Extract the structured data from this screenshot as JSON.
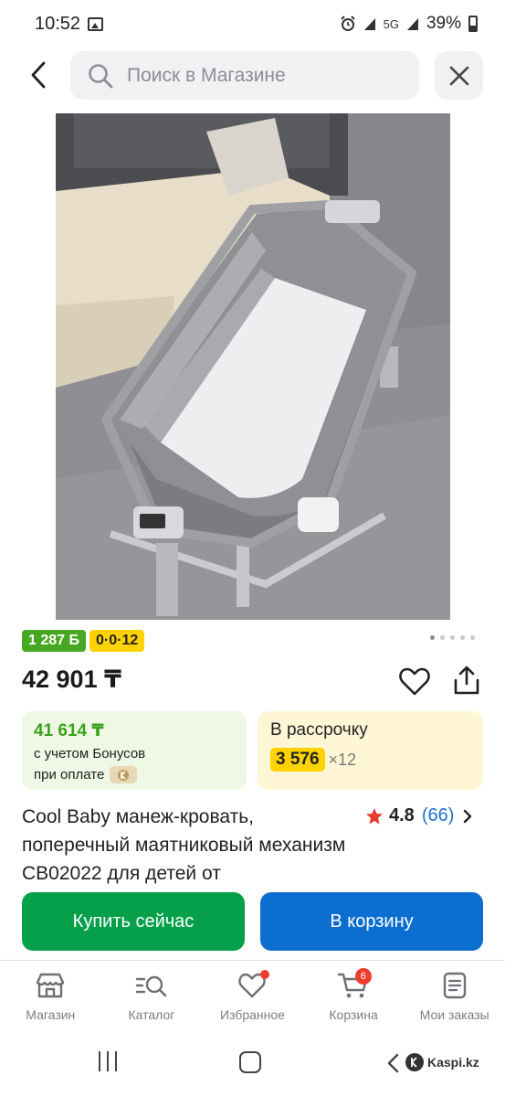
{
  "status_bar": {
    "time": "10:52",
    "network": "5G",
    "battery": "39%",
    "icons": [
      "gallery-icon",
      "alarm-icon",
      "signal-icon",
      "wifi-icon",
      "battery-icon"
    ]
  },
  "search": {
    "placeholder": "Поиск в Магазине",
    "icons": [
      "back-arrow-icon",
      "search-icon",
      "close-icon"
    ]
  },
  "product": {
    "image_alt": "Приставная кроватка-манеж серого цвета",
    "bonus_badge": "1 287 Б",
    "installment_badge": "0·0·12",
    "carousel": {
      "count": 5,
      "active_index": 0
    },
    "price": "42 901 ₸",
    "title": "Cool Baby манеж-кровать, поперечный маятниковый механизм CB02022 для детей от",
    "rating": {
      "value": "4.8",
      "reviews": "(66)"
    }
  },
  "bonus_offer": {
    "amount": "41 614 ₸",
    "line1": "с учетом Бонусов",
    "line2": "при оплате"
  },
  "credit_offer": {
    "title": "В рассрочку",
    "monthly": "3 576",
    "months": "×12"
  },
  "actions": {
    "buy_now": "Купить сейчас",
    "add_to_cart": "В корзину"
  },
  "bottom_nav": [
    {
      "label": "Магазин",
      "icon": "store-icon"
    },
    {
      "label": "Каталог",
      "icon": "catalog-search-icon"
    },
    {
      "label": "Избранное",
      "icon": "heart-icon",
      "dot": true
    },
    {
      "label": "Корзина",
      "icon": "cart-icon",
      "badge": "6"
    },
    {
      "label": "Мои заказы",
      "icon": "orders-icon"
    }
  ],
  "watermark": "Kaspi.kz",
  "colors": {
    "green_badge": "#46a820",
    "yellow_badge": "#ffd200",
    "buy_button": "#07a04a",
    "cart_button": "#0d6ed1",
    "link_blue": "#1e6fd0",
    "star": "#e8392f"
  }
}
